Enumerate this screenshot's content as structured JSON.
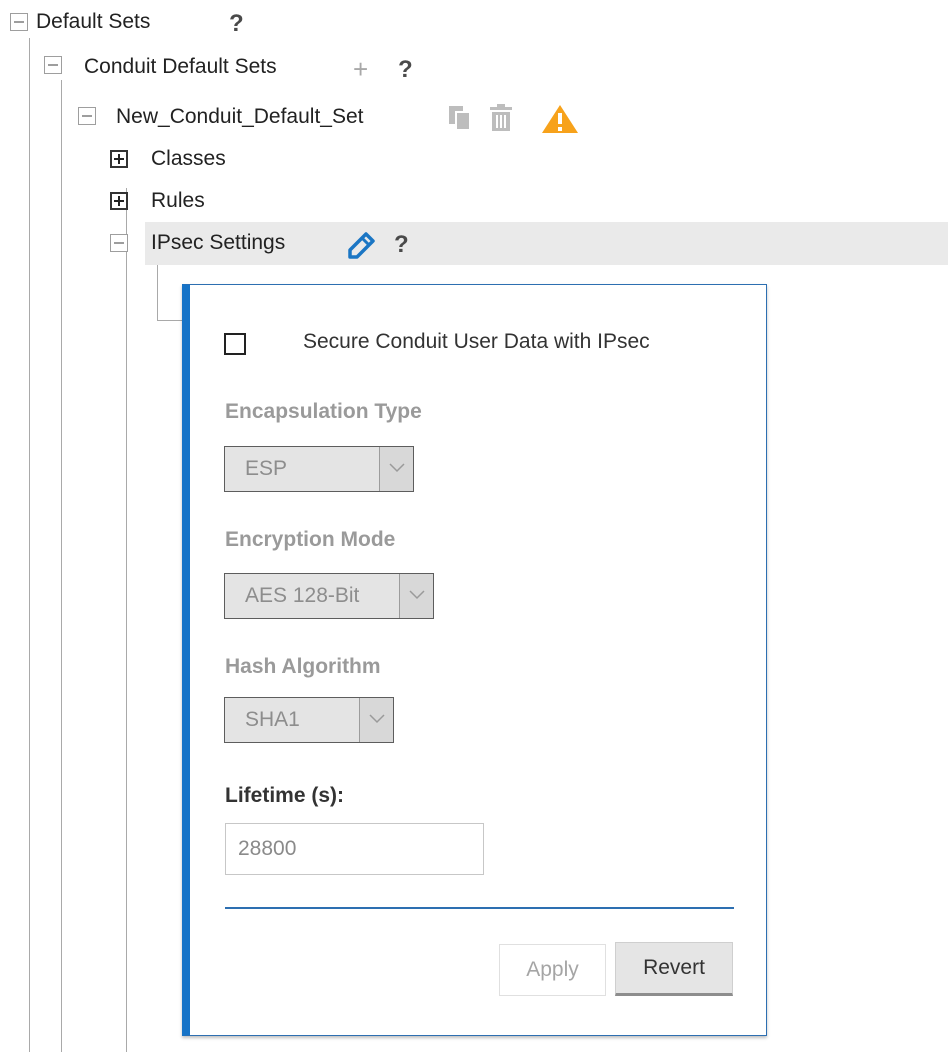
{
  "tree": {
    "default_sets": {
      "label": "Default Sets",
      "help": "?"
    },
    "conduit_default_sets": {
      "label": "Conduit Default Sets",
      "add": "+",
      "help": "?"
    },
    "new_conduit_default_set": {
      "label": "New_Conduit_Default_Set",
      "copy_icon": "copy-icon",
      "delete_icon": "trash-icon",
      "warning_icon": "warning-icon",
      "warning_color": "#f7a21b"
    },
    "classes": {
      "label": "Classes"
    },
    "rules": {
      "label": "Rules"
    },
    "ipsec_settings": {
      "label": "IPsec Settings",
      "edit_icon": "pencil-icon",
      "edit_color": "#1b76c4",
      "help": "?"
    }
  },
  "panel": {
    "secure_checkbox": {
      "label": "Secure Conduit User Data with IPsec",
      "checked": false
    },
    "encapsulation": {
      "title": "Encapsulation Type",
      "value": "ESP"
    },
    "encryption": {
      "title": "Encryption Mode",
      "value": "AES 128-Bit"
    },
    "hash": {
      "title": "Hash Algorithm",
      "value": "SHA1"
    },
    "lifetime": {
      "title": "Lifetime (s):",
      "value": "28800"
    },
    "apply_label": "Apply",
    "revert_label": "Revert",
    "accent_color": "#1673c7"
  }
}
